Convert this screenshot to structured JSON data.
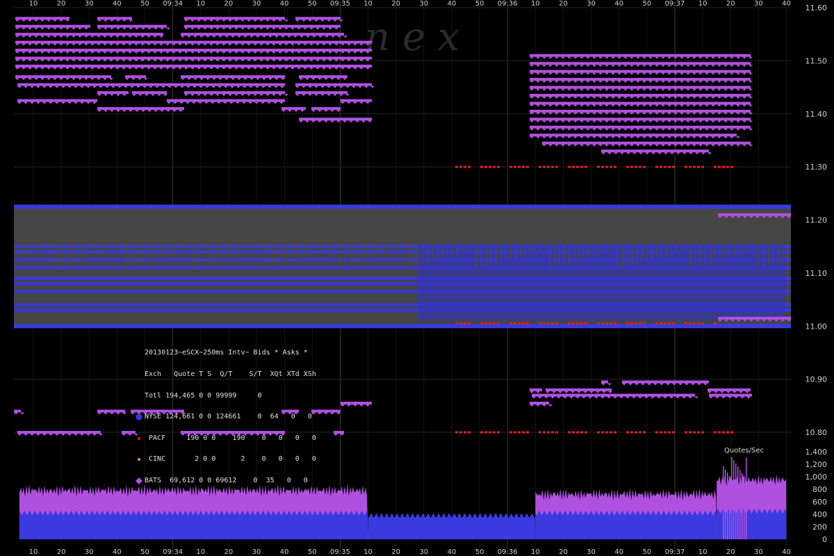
{
  "chart_data": {
    "type": "scatter",
    "title": "20130123~eSCX~250ms Intv~ Bids * Asks *",
    "x_axis": {
      "top_ticks": [
        "10",
        "20",
        "30",
        "40",
        "50",
        "09:34",
        "10",
        "20",
        "30",
        "40",
        "50",
        "09:35",
        "10",
        "20",
        "30",
        "40",
        "50",
        "09:36",
        "10",
        "20",
        "30",
        "40",
        "50",
        "09:37",
        "10",
        "20",
        "30",
        "40"
      ],
      "bottom_ticks": [
        "10",
        "20",
        "30",
        "40",
        "50",
        "09:34",
        "10",
        "20",
        "30",
        "40",
        "50",
        "09:35",
        "10",
        "20",
        "30",
        "40",
        "50",
        "09:36",
        "10",
        "20",
        "30",
        "40",
        "50",
        "09:37",
        "10",
        "20",
        "30",
        "40"
      ]
    },
    "price_axis": {
      "ticks": [
        "11.60",
        "11.50",
        "11.40",
        "11.30",
        "11.20",
        "11.10",
        "11.00",
        "10.90",
        "10.80"
      ],
      "range": [
        10.78,
        11.62
      ]
    },
    "rate_axis": {
      "label": "Quotes/Sec",
      "ticks": [
        "1,400",
        "1,200",
        "1,000",
        "800",
        "600",
        "400",
        "200",
        "0"
      ],
      "range": [
        0,
        1400
      ]
    },
    "series": [
      {
        "name": "NYSE",
        "color": "#3a3ae0",
        "marker": "circle"
      },
      {
        "name": "PACF",
        "color": "#e02020",
        "marker": "small-dot"
      },
      {
        "name": "CINC",
        "color": "#e0a020",
        "marker": "small-dot"
      },
      {
        "name": "BATS",
        "color": "#b050e0",
        "marker": "diamond"
      }
    ],
    "legend_table": {
      "title": "20130123~eSCX~250ms Intv~ Bids * Asks *",
      "header": "Exch   Quote T S  Q/T    S/T  XQt XTd XSh",
      "total": "Totl 194,465 0 0 99999     0",
      "rows": [
        {
          "text": "NYSE 124,661 0 0 124661    0  64   0   0",
          "series": "NYSE"
        },
        {
          "text": " PACF     190 0 0    190    0   0   0   0",
          "series": "PACF"
        },
        {
          "text": " CINC       2 0 0      2    0   0   0   0",
          "series": "CINC"
        },
        {
          "text": "BATS  69,612 0 0 69612    0  35   0   0",
          "series": "BATS"
        }
      ]
    },
    "quote_rate": {
      "segments": [
        {
          "from": "09:33:05",
          "to": "09:35:10",
          "BATS_level": 780,
          "NYSE_level": 420
        },
        {
          "from": "09:35:10",
          "to": "09:36:10",
          "BATS_level": 0,
          "NYSE_level": 380
        },
        {
          "from": "09:36:10",
          "to": "09:37:15",
          "BATS_level": 720,
          "NYSE_level": 420
        },
        {
          "from": "09:37:15",
          "to": "09:37:40",
          "BATS_level": 950,
          "NYSE_level": 450
        }
      ],
      "peak": 1350
    },
    "watermark": "n   e   x",
    "grid": true
  }
}
